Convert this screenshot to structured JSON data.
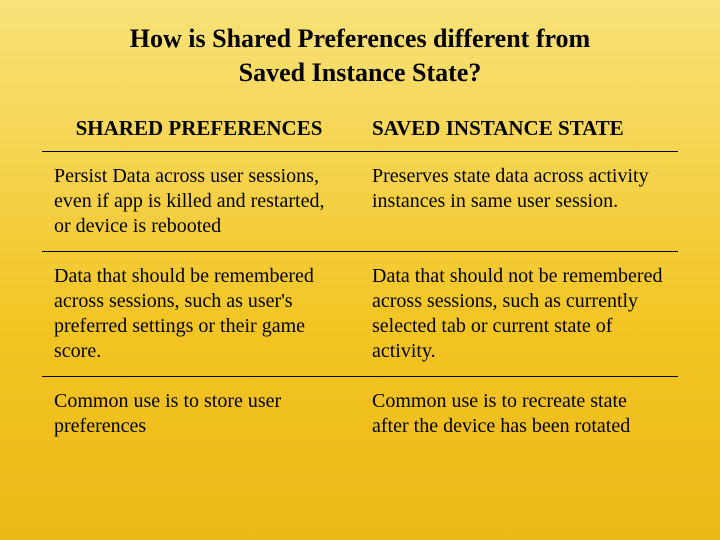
{
  "title_line1": "How is Shared Preferences different from",
  "title_line2": "Saved Instance State?",
  "headers": {
    "left": "SHARED PREFERENCES",
    "right": "SAVED INSTANCE STATE"
  },
  "rows": [
    {
      "left": "Persist Data across user sessions, even if app is killed and restarted, or device is rebooted",
      "right": "Preserves state data across activity instances in same user session."
    },
    {
      "left": "Data that should be remembered across sessions, such as user's preferred settings or their game score.",
      "right": "Data that should not be remembered across sessions, such as currently selected tab or current state of activity."
    },
    {
      "left": "Common use is to store user preferences",
      "right": "Common use is to recreate state after the device has been rotated"
    }
  ]
}
